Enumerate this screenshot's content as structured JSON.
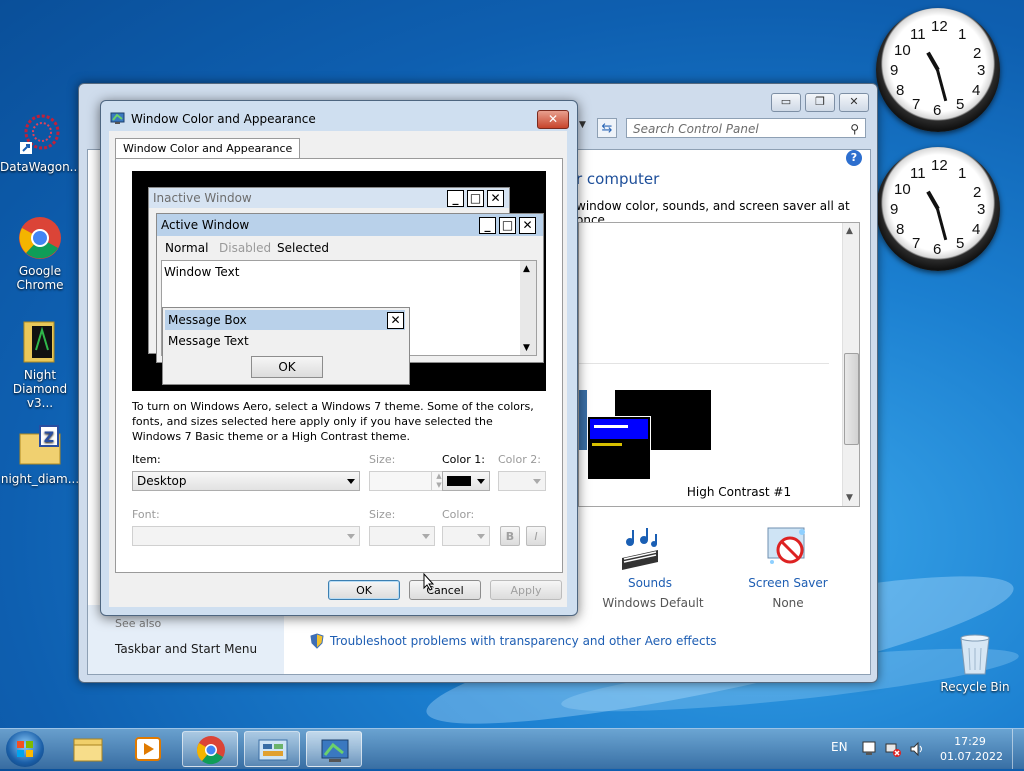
{
  "desktop": {
    "icons": [
      {
        "label": "DataWagon..."
      },
      {
        "label": "Google Chrome"
      },
      {
        "label": "Night Diamond v3..."
      },
      {
        "label": "night_diam..."
      },
      {
        "label": "Recycle Bin"
      }
    ]
  },
  "clocks": {
    "numbers": [
      "12",
      "1",
      "2",
      "3",
      "4",
      "5",
      "6",
      "7",
      "8",
      "9",
      "10",
      "11"
    ]
  },
  "control_panel": {
    "search_placeholder": "Search Control Panel",
    "heading_partial": "r computer",
    "subtitle_partial": "window color, sounds, and screen saver all at once.",
    "theme_name": "High Contrast #1",
    "sounds_label": "Sounds",
    "sounds_value": "Windows Default",
    "screensaver_label": "Screen Saver",
    "screensaver_value": "None",
    "see_also": "See also",
    "taskbar_link": "Taskbar and Start Menu",
    "troubleshoot_link": "Troubleshoot problems with transparency and other Aero effects"
  },
  "dialog": {
    "title": "Window Color and Appearance",
    "tab": "Window Color and Appearance",
    "preview": {
      "inactive_window": "Inactive Window",
      "active_window": "Active Window",
      "menu_normal": "Normal",
      "menu_disabled": "Disabled",
      "menu_selected": "Selected",
      "window_text": "Window Text",
      "message_box": "Message Box",
      "message_text": "Message Text",
      "ok": "OK"
    },
    "info_text": "To turn on Windows Aero, select a Windows 7 theme.  Some of the colors, fonts, and sizes selected here apply only if you have selected the Windows 7 Basic theme or a High Contrast theme.",
    "item_label": "Item:",
    "item_value": "Desktop",
    "size_label": "Size:",
    "color1_label": "Color 1:",
    "color2_label": "Color 2:",
    "font_label": "Font:",
    "size2_label": "Size:",
    "color_label": "Color:",
    "bold_label": "B",
    "italic_label": "I",
    "ok_button": "OK",
    "cancel_button": "Cancel",
    "apply_button": "Apply"
  },
  "taskbar": {
    "language": "EN",
    "time": "17:29",
    "date": "01.07.2022"
  },
  "colors": {
    "active_title": "#b9d1ea",
    "inactive_title": "#d6e3f2",
    "link": "#1e5eb3",
    "high_contrast_blue": "#0000ff",
    "high_contrast_yellow": "#d8c000"
  }
}
